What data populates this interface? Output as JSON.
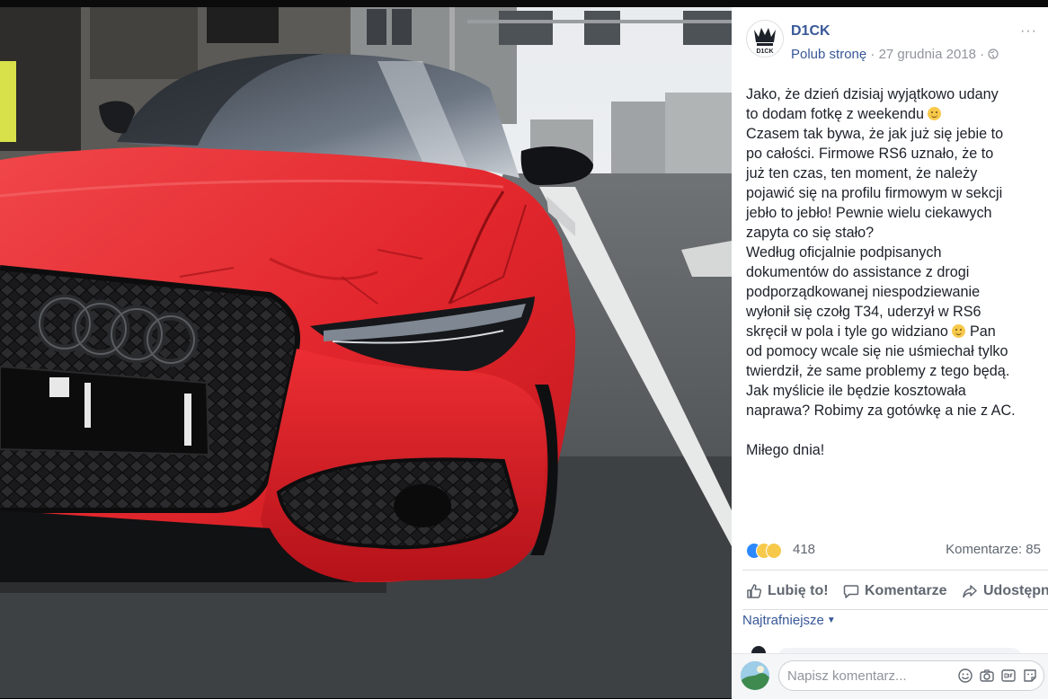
{
  "post": {
    "page_name": "D1CK",
    "like_page_label": "Polub stronę",
    "separator": " · ",
    "date": "27 grudnia 2018",
    "meta_suffix": " · ",
    "menu": "···",
    "lines": [
      "Jako, że dzień dzisiaj wyjątkowo udany",
      "to dodam fotkę z weekendu",
      "Czasem tak bywa, że jak już się jebie to",
      "po całości. Firmowe RS6 uznało, że to",
      "już ten czas, ten moment, że należy",
      "pojawić się na profilu firmowym w sekcji",
      "jebło to jebło! Pewnie wielu ciekawych",
      "zapyta co się stało?",
      "Według oficjalnie podpisanych",
      "dokumentów do assistance z drogi",
      "podporządkowanej niespodziewanie",
      "wyłonił się czołg T34, uderzył w RS6",
      "skręcił w pola i tyle go widziano",
      "Pan",
      "od pomocy wcale się nie uśmiechał tylko",
      "twierdził, że same problemy z tego będą.",
      "Jak myślicie ile będzie kosztowała",
      "naprawa? Robimy za gotówkę a nie z AC.",
      "Miłego dnia!"
    ],
    "logo_text": "D1CK"
  },
  "stats": {
    "reactions_count": "418",
    "comments_label": "Komentarze: 85"
  },
  "actions": {
    "like": "Lubię to!",
    "comment": "Komentarze",
    "share": "Udostępnij"
  },
  "comments": {
    "sort_label": "Najtrafniejsze",
    "composer_placeholder": "Napisz komentarz..."
  },
  "icons": {
    "reaction_types": [
      "like",
      "sad",
      "haha"
    ],
    "composer": [
      "emoji-icon",
      "camera-icon",
      "gif-icon",
      "sticker-icon"
    ]
  },
  "colors": {
    "link": "#385898",
    "secondary_text": "#90949c",
    "car_body": "#e0262c"
  }
}
